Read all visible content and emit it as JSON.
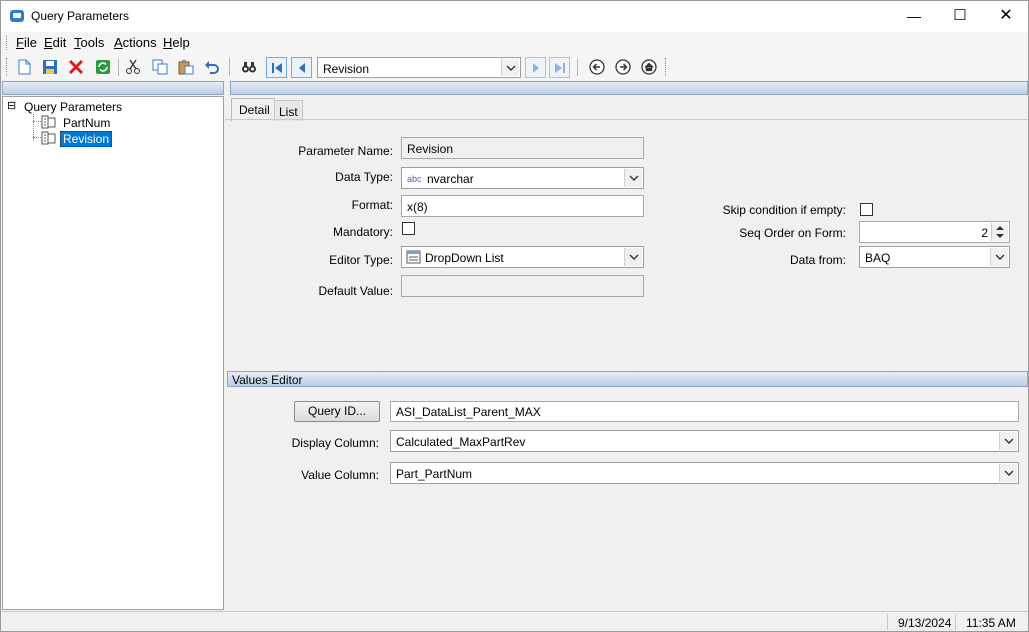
{
  "window": {
    "title": "Query Parameters",
    "minimize_glyph": "—",
    "maximize_glyph": "☐",
    "close_glyph": "✕"
  },
  "menu": {
    "items": [
      {
        "key": "F",
        "rest": "ile"
      },
      {
        "key": "E",
        "rest": "dit"
      },
      {
        "key": "T",
        "rest": "ools"
      },
      {
        "key": "A",
        "rest": "ctions"
      },
      {
        "key": "H",
        "rest": "elp"
      }
    ]
  },
  "toolbar": {
    "nav_combo_value": "Revision",
    "icons": [
      "new-icon",
      "save-icon",
      "delete-icon",
      "refresh-icon",
      "cut-icon",
      "copy-icon",
      "paste-icon",
      "undo-icon",
      "find-icon",
      "first-record-icon",
      "previous-record-icon",
      "next-record-icon",
      "last-record-icon",
      "back-icon",
      "forward-icon",
      "home-icon"
    ]
  },
  "tree": {
    "root": "Query Parameters",
    "root_toggle": "⊟",
    "children": [
      "PartNum",
      "Revision"
    ],
    "selected": "Revision"
  },
  "tabs": {
    "detail": "Detail",
    "list": "List"
  },
  "detail": {
    "parameter_name_label": "Parameter Name:",
    "parameter_name_value": "Revision",
    "data_type_label": "Data Type:",
    "data_type_prefix": "abc",
    "data_type_value": "nvarchar",
    "format_label": "Format:",
    "format_value": "x(8)",
    "mandatory_label": "Mandatory:",
    "mandatory_checked": false,
    "editor_type_label": "Editor Type:",
    "editor_type_value": "DropDown List",
    "default_value_label": "Default Value:",
    "default_value_value": "",
    "skip_label": "Skip condition if empty:",
    "skip_checked": false,
    "seq_label": "Seq Order on Form:",
    "seq_value": "2",
    "data_from_label": "Data from:",
    "data_from_value": "BAQ"
  },
  "values_editor": {
    "header": "Values Editor",
    "query_button": "Query ID...",
    "query_id_value": "ASI_DataList_Parent_MAX",
    "display_column_label": "Display Column:",
    "display_column_value": "Calculated_MaxPartRev",
    "value_column_label": "Value Column:",
    "value_column_value": "Part_PartNum"
  },
  "status": {
    "date": "9/13/2024",
    "time": "11:35 AM"
  },
  "colors": {
    "selection": "#0078d7",
    "panel_header": "#bccde2"
  }
}
